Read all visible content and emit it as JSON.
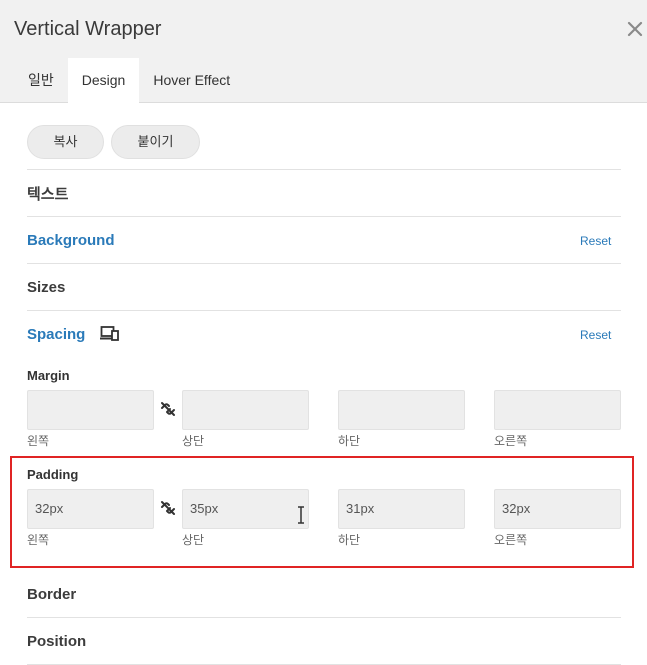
{
  "header": {
    "title": "Vertical Wrapper",
    "tabs": [
      {
        "label": "일반"
      },
      {
        "label": "Design",
        "active": true
      },
      {
        "label": "Hover Effect"
      }
    ]
  },
  "actions": {
    "copy_label": "복사",
    "paste_label": "붙이기"
  },
  "sections": {
    "text": "텍스트",
    "background": "Background",
    "sizes": "Sizes",
    "spacing": "Spacing",
    "border": "Border",
    "position": "Position"
  },
  "reset_label": "Reset",
  "margin": {
    "label": "Margin",
    "fields": [
      {
        "caption": "왼쪽",
        "value": ""
      },
      {
        "caption": "상단",
        "value": ""
      },
      {
        "caption": "하단",
        "value": ""
      },
      {
        "caption": "오른쪽",
        "value": ""
      }
    ]
  },
  "padding": {
    "label": "Padding",
    "fields": [
      {
        "caption": "왼쪽",
        "value": "32px"
      },
      {
        "caption": "상단",
        "value": "35px"
      },
      {
        "caption": "하단",
        "value": "31px"
      },
      {
        "caption": "오른쪽",
        "value": "32px"
      }
    ]
  },
  "colors": {
    "accent": "#2a7ab9",
    "highlight": "#e02424",
    "header_bg": "#f1f1f1",
    "field_bg": "#efefef"
  },
  "icons": {
    "close": "close-icon",
    "link": "unlink-icon",
    "device": "responsive-device-icon",
    "cursor": "text-cursor-icon"
  }
}
